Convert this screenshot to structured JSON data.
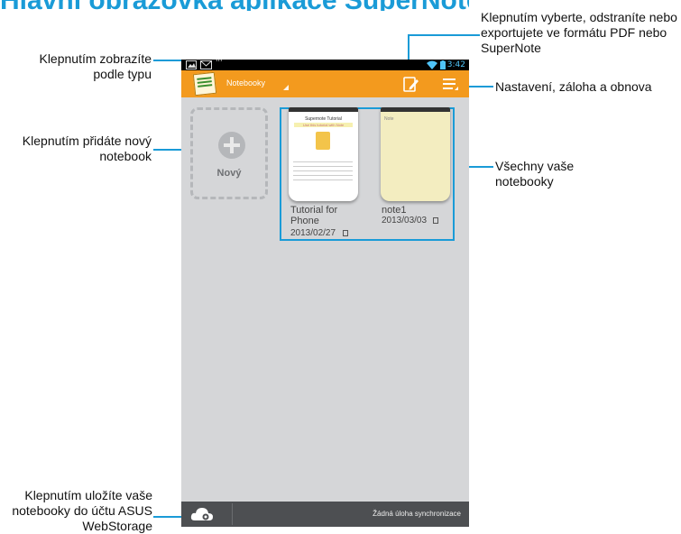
{
  "heading": "Hlavní obrazovka aplikace SuperNote",
  "callouts": {
    "type_view": "Klepnutím zobrazíte podle typu",
    "add_notebook": "Klepnutím přidáte nový notebook",
    "save_to_webstorage": "Klepnutím uložíte vaše notebooky do účtu ASUS WebStorage",
    "select_delete_export": "Klepnutím vyberte, odstraníte nebo exportujete ve formátu PDF nebo SuperNote",
    "settings": "Nastavení, záloha a obnova",
    "all_notebooks": "Všechny vaše notebooky"
  },
  "status_bar": {
    "time": "3:42"
  },
  "action_bar": {
    "type_selector": "Notebooky"
  },
  "new_notebook": {
    "label": "Nový"
  },
  "notebooks": [
    {
      "name": "Tutorial for Phone",
      "date": "2013/02/27",
      "cover_title": "Supernote Tutorial",
      "cover_subtitle": "Use this tutorial with Note"
    },
    {
      "name": "note1",
      "date": "2013/03/03",
      "cover_text": "Note"
    }
  ],
  "bottom_bar": {
    "sync_status": "Žádná úloha synchronizace"
  },
  "colors": {
    "accent": "#1a9bd7",
    "action_bar": "#f39a1e",
    "screen_bg": "#d5d6d8",
    "bottom_bar": "#4d4f52"
  },
  "icons": [
    "image-icon",
    "gmail-icon",
    "wifi-icon",
    "battery-icon",
    "edit-notebook-icon",
    "menu-icon",
    "add-icon",
    "cloud-settings-icon"
  ]
}
